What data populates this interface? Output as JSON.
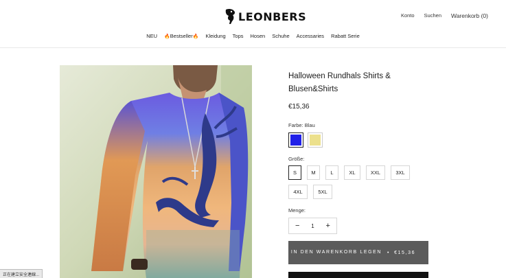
{
  "brand": {
    "name": "LEONBERS"
  },
  "header_links": {
    "account": "Konto",
    "search": "Suchen",
    "cart": "Warenkorb (0)"
  },
  "nav": {
    "items": [
      {
        "label": "NEU",
        "hot": false
      },
      {
        "label": "Bestseller",
        "hot": true
      },
      {
        "label": "Kleidung",
        "hot": false
      },
      {
        "label": "Tops",
        "hot": false
      },
      {
        "label": "Hosen",
        "hot": false
      },
      {
        "label": "Schuhe",
        "hot": false
      },
      {
        "label": "Accessaries",
        "hot": false
      },
      {
        "label": "Rabatt Serie",
        "hot": false
      }
    ],
    "hot_glyph": "🔥"
  },
  "product": {
    "title": "Halloween Rundhals Shirts & Blusen&Shirts",
    "price": "€15,36",
    "color_label": "Farbe: Blau",
    "colors": [
      {
        "name": "Blau",
        "hex": "#2020e8",
        "selected": true
      },
      {
        "name": "Gelb",
        "hex": "#ece08c",
        "selected": false
      }
    ],
    "size_label": "Größe:",
    "sizes": [
      {
        "label": "S",
        "selected": true
      },
      {
        "label": "M",
        "selected": false
      },
      {
        "label": "L",
        "selected": false
      },
      {
        "label": "XL",
        "selected": false
      },
      {
        "label": "XXL",
        "selected": false
      },
      {
        "label": "3XL",
        "selected": false
      },
      {
        "label": "4XL",
        "selected": false
      },
      {
        "label": "5XL",
        "selected": false
      }
    ],
    "quantity_label": "Menge:",
    "quantity": "1",
    "minus": "−",
    "plus": "+"
  },
  "cart_button": {
    "label": "IN DEN WARENKORB LEGEN",
    "separator": "•",
    "price": "€15,36"
  },
  "status_bar": {
    "text": "正在建立安全連線..."
  }
}
